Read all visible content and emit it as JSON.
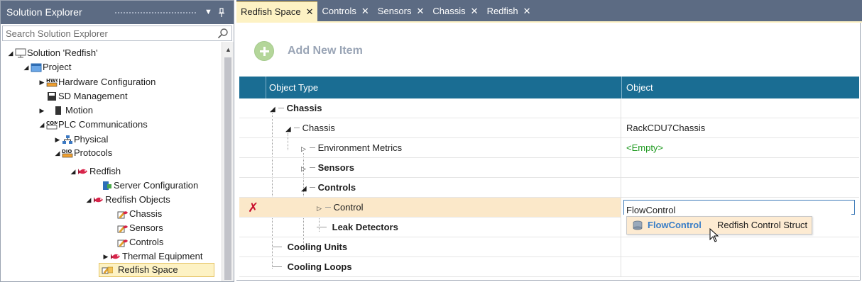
{
  "solution_explorer": {
    "title": "Solution Explorer",
    "search_placeholder": "Search Solution Explorer",
    "tree": [
      {
        "label": "Solution 'Redfish'",
        "icon": "solution-icon"
      },
      {
        "label": "Project",
        "icon": "project-icon"
      },
      {
        "label": "Hardware Configuration",
        "icon": "hardware-config-icon"
      },
      {
        "label": "SD Management",
        "icon": "sd-management-icon"
      },
      {
        "label": "Motion",
        "icon": "motion-icon"
      },
      {
        "label": "PLC Communications",
        "icon": "communications-icon"
      },
      {
        "label": "Physical",
        "icon": "physical-network-icon"
      },
      {
        "label": "Protocols",
        "icon": "protocols-icon"
      },
      {
        "label": "Redfish",
        "icon": "redfish-icon"
      },
      {
        "label": "Server Configuration",
        "icon": "server-config-icon"
      },
      {
        "label": "Redfish Objects",
        "icon": "redfish-icon"
      },
      {
        "label": "Chassis",
        "icon": "redfish-object-icon"
      },
      {
        "label": "Sensors",
        "icon": "redfish-object-icon"
      },
      {
        "label": "Controls",
        "icon": "redfish-object-icon"
      },
      {
        "label": "Thermal Equipment",
        "icon": "redfish-icon"
      },
      {
        "label": "Redfish Space",
        "icon": "redfish-space-icon"
      }
    ],
    "selected_item": "Redfish Space"
  },
  "tabs": [
    {
      "label": "Redfish Space",
      "active": true
    },
    {
      "label": "Controls",
      "active": false
    },
    {
      "label": "Sensors",
      "active": false
    },
    {
      "label": "Chassis",
      "active": false
    },
    {
      "label": "Redfish",
      "active": false
    }
  ],
  "editor": {
    "add_new_item_label": "Add New Item",
    "columns": [
      "Object Type",
      "Object"
    ],
    "rows": [
      {
        "type": "Chassis",
        "object": "",
        "bold": true
      },
      {
        "type": "Chassis",
        "object": "RackCDU7Chassis",
        "bold": false
      },
      {
        "type": "Environment Metrics",
        "object": "<Empty>",
        "bold": false
      },
      {
        "type": "Sensors",
        "object": "",
        "bold": true
      },
      {
        "type": "Controls",
        "object": "",
        "bold": true
      },
      {
        "type": "Control",
        "object": "FlowControl",
        "bold": false
      },
      {
        "type": "Leak Detectors",
        "object": "",
        "bold": true
      },
      {
        "type": "Cooling Units",
        "object": "",
        "bold": true
      },
      {
        "type": "Cooling Loops",
        "object": "",
        "bold": true
      }
    ],
    "delete_glyph": "✗",
    "autocomplete": {
      "name": "FlowControl",
      "description": "Redfish Control Struct"
    }
  },
  "colors": {
    "title_bar": "#5c6b83",
    "active_tab": "#fdf2c4",
    "grid_header": "#1a6d93",
    "current_row": "#fbe8c9",
    "empty_value": "#1f9a20",
    "delete_icon": "#c8102e"
  }
}
